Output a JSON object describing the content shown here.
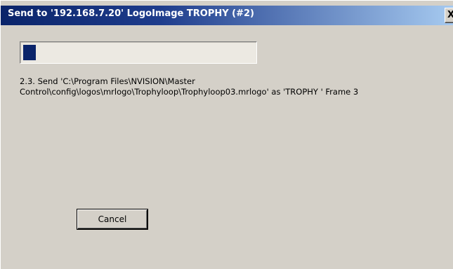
{
  "window": {
    "title": "Send to '192.168.7.20' LogoImage TROPHY  (#2)",
    "close_label": "X"
  },
  "progress": {
    "fraction": 0.055
  },
  "status": {
    "line1": "2.3. Send 'C:\\Program Files\\NVISION\\Master",
    "line2": "Control\\config\\logos\\mrlogo\\Trophyloop\\Trophyloop03.mrlogo' as 'TROPHY  '  Frame 3"
  },
  "buttons": {
    "cancel_label": "Cancel"
  },
  "colors": {
    "title_bar": "#0a246a",
    "progress_fill": "#0a246a",
    "dialog_background": "#d4d0c8"
  }
}
